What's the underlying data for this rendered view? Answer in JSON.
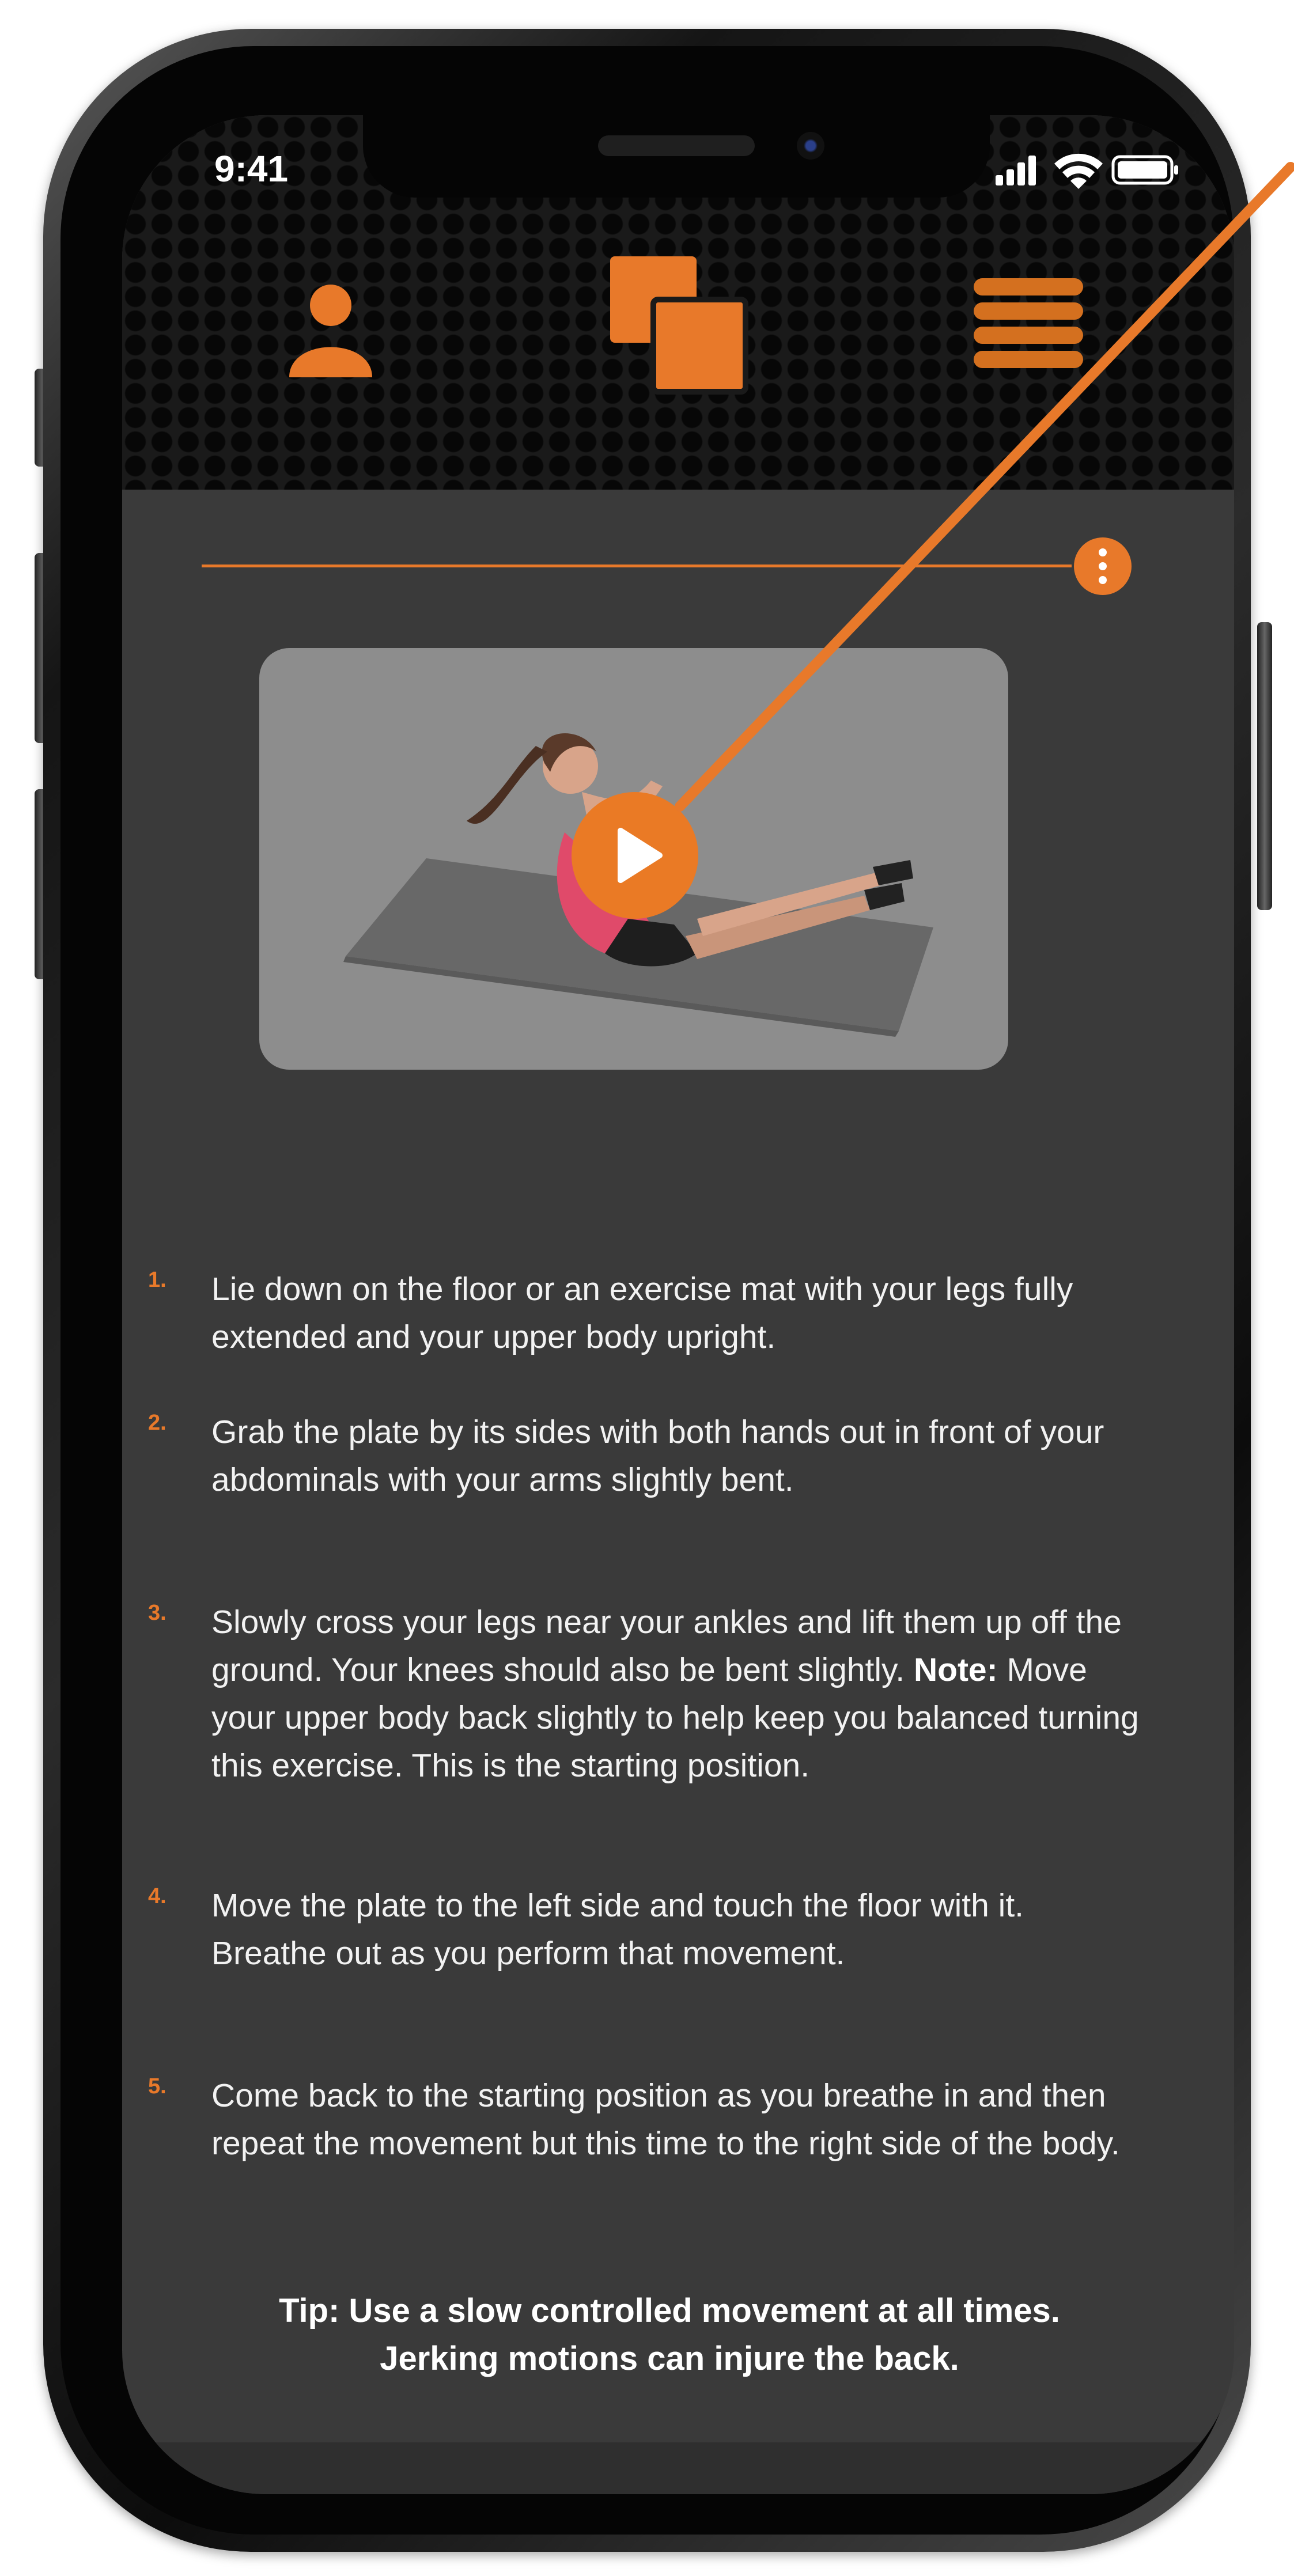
{
  "status_bar": {
    "time": "9:41"
  },
  "header": {
    "icons": [
      "user-icon",
      "app-logo-icon",
      "menu-icon"
    ]
  },
  "colors": {
    "accent": "#E8792A",
    "background": "#3A3A3A",
    "text": "#F2F2F2"
  },
  "video": {
    "play_icon": "play-icon"
  },
  "steps": [
    {
      "num": "1.",
      "text": "Lie down on the floor or an exercise mat with your legs fully extended and your upper body upright."
    },
    {
      "num": "2.",
      "text": "Grab the plate by its sides with both hands out in front of your abdominals with your arms slightly bent."
    },
    {
      "num": "3.",
      "text_before": "Slowly cross your legs near your ankles and lift them up off the ground. Your knees should also be bent slightly. ",
      "note_label": "Note:",
      "text_after": " Move your upper body back slightly to help keep you balanced turning this exercise. This is the starting position."
    },
    {
      "num": "4.",
      "text": "Move the plate to the left side and touch the floor with it. Breathe out as you perform that movement."
    },
    {
      "num": "5.",
      "text": "Come back to the starting position as you breathe in and then repeat the movement but this time to the right side of the body."
    }
  ],
  "tip": {
    "line1": "Tip: Use a slow controlled movement at all times.",
    "line2": "Jerking motions can injure the back."
  }
}
